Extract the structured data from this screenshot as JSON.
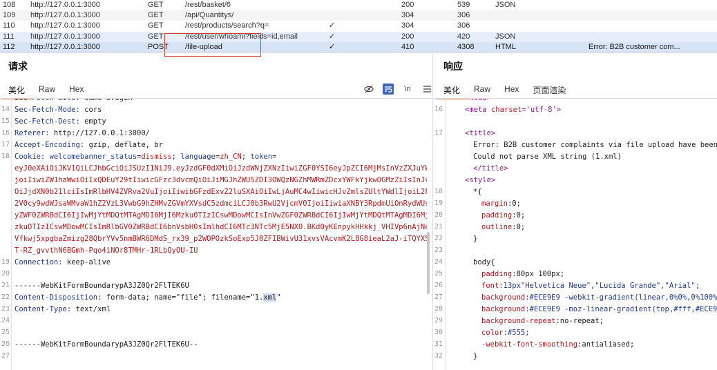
{
  "requests": [
    {
      "num": "108",
      "host": "http://127.0.0.1:3000",
      "method": "GET",
      "url": "/rest/basket/6",
      "check": "",
      "status": "200",
      "length": "539",
      "mime": "JSON",
      "comment": ""
    },
    {
      "num": "109",
      "host": "http://127.0.0.1:3000",
      "method": "GET",
      "url": "/api/Quantitys/",
      "check": "",
      "status": "304",
      "length": "306",
      "mime": "",
      "comment": ""
    },
    {
      "num": "110",
      "host": "http://127.0.0.1:3000",
      "method": "GET",
      "url": "/rest/products/search?q=",
      "check": "✓",
      "status": "304",
      "length": "306",
      "mime": "",
      "comment": ""
    },
    {
      "num": "111",
      "host": "http://127.0.0.1:3000",
      "method": "GET",
      "url": "/rest/user/whoami?fields=id,email",
      "check": "✓",
      "status": "200",
      "length": "420",
      "mime": "JSON",
      "comment": ""
    },
    {
      "num": "112",
      "host": "http://127.0.0.1:3000",
      "method": "POST",
      "url": "/file-upload",
      "check": "✓",
      "status": "410",
      "length": "4308",
      "mime": "HTML",
      "comment": "Error: B2B customer com..."
    }
  ],
  "request_panel": {
    "title": "请求",
    "tabs": [
      "美化",
      "Raw",
      "Hex"
    ],
    "tools": {
      "hide": "⊘",
      "wrap": "≡",
      "newline": "\\n",
      "menu": "☰"
    }
  },
  "response_panel": {
    "title": "响应",
    "tabs": [
      "美化",
      "Raw",
      "Hex",
      "页面渲染"
    ]
  },
  "request_lines": [
    {
      "n": "13",
      "k": "Sec-Fetch-Site:",
      "v": " same-origin"
    },
    {
      "n": "14",
      "k": "Sec-Fetch-Mode:",
      "v": " cors"
    },
    {
      "n": "15",
      "k": "Sec-Fetch-Dest:",
      "v": " empty"
    },
    {
      "n": "16",
      "k": "Referer:",
      "v": " http://127.0.0.1:3000/"
    },
    {
      "n": "17",
      "k": "Accept-Encoding:",
      "v": " gzip, deflate, br"
    },
    {
      "n": "18",
      "k": "Cookie:",
      "v": " "
    }
  ],
  "cookie": {
    "p1k": "welcomebanner_status",
    "p1v": "dismiss",
    "p2k": "language",
    "p2v": "zh_CN",
    "p3k": "token",
    "token_lines": [
      "eyJ0eXAiOiJKV1QiLCJhbGciOiJSUzI1NiJ9.eyJzdGF0dXMiOiJzdWNjZXNzIiwiZGF0YSI6eyJpZCI6MjMsInVzZXJuYW1lI",
      "joiIiwiZW1haWwiOiIxQDEuY29tIiwicGFzc3dvcmQiOiJiMGJhZWU5ZDI3OWQzNGZhMWRmZDcxYWFkYjkwOGMzZiIsInJvbGUi",
      "OiJjdXN0b21lciIsImRlbHV4ZVRva2VuIjoiIiwibGFzdExvZ2luSXAiOiIwLjAuMC4wIiwicHJvZmlsZUltYWdlIjoiL2Fzc",
      "2V0cy9wdWJsaWMvaW1hZ2VzL3VwbG9hZHMvZGVmYXVsdC5zdmciLCJ0b3RwU2VjcmV0IjoiIiwiaXNBY3RpdmUiOnRydWUsImN",
      "yZWF0ZWRBdCI6IjIwMjYtMDQtMTAgMDI6MjI6Mzku0TIzICswMDowMCIsInVwZGF0ZWRBdCI6IjIwMjYtMDQtMTAgMDI6MjI6M",
      "zkuOTIzICswMDowMCIsImRlbGV0ZWRBdCI6bnVsbH0sImlhdCI6MTc3NTc5MjE5NX0.BKd0yKEnpykHHkkj_VHIVp6nAjNeqgQ",
      "Vfkwj5xpgbaZmizg28QbrYVv5nmBWR6DMdS_rx39_p2WOPOzkSoExp5J0ZFIBWivU31xvsVAcvmK2L8G8ieaL2aJ-iTQYXS-Bp",
      "T-RZ_gvvthN6BGmh-Pqo4iNOr8TMHr-1RLbQyOU-IU"
    ]
  },
  "request_tail": [
    {
      "n": "19",
      "k": "Connection:",
      "v": " keep-alive"
    },
    {
      "n": "20",
      "t": ""
    },
    {
      "n": "21",
      "t": "------WebKitFormBoundarypA3JZ0Qr2FlTEK6U"
    },
    {
      "n": "22",
      "k": "Content-Disposition:",
      "v": " form-data; name=\"file\"; filename=\"1.",
      "hl": "xml",
      "v2": "\""
    },
    {
      "n": "23",
      "k": "Content-Type:",
      "v": " text/xml"
    },
    {
      "n": "24",
      "t": ""
    },
    {
      "n": "25",
      "t": ""
    },
    {
      "n": "26",
      "t": "------WebKitFormBoundarypA3JZ0Qr2FlTEK6U--"
    },
    {
      "n": "27",
      "t": ""
    }
  ],
  "response_lines": {
    "l15": "<head>",
    "l16_tag": "<meta ",
    "l16_attr": "charset",
    "l16_val": "='utf-8'>",
    "l17": "<title>",
    "l18": "Error: B2B customer complaints via file upload have been de",
    "l18b": "Could not parse XML string (1.xml)",
    "l19": "</title>",
    "l20": "<style>",
    "l21": "*{",
    "l22p": "margin",
    "l22v": ":0;",
    "l23p": "padding",
    "l23v": ":0;",
    "l24p": "outline",
    "l24v": ":0;",
    "l25": "}",
    "l26": "",
    "l27": "body{",
    "l28p": "padding",
    "l28v": ":80px 100px;",
    "l29p": "font",
    "l29v": ":13px\"Helvetica Neue\",\"Lucida Grande\",\"Arial\";",
    "l30p": "background",
    "l30v": ":#ECE9E9 -webkit-gradient(linear,0%0%,0%100%,fro",
    "l31p": "background",
    "l31v": ":#ECE9E9 -moz-linear-gradient(top,#fff,#ECE9E9);",
    "l32p": "background-repeat",
    "l32v": ":no-repeat;",
    "l33p": "color",
    "l33v": ":#555;",
    "l34p": "-webkit-font-smoothing",
    "l34v": ":antialiased;",
    "l35": "}",
    "nums": [
      "15",
      "16",
      "",
      "17",
      "",
      "",
      "",
      "",
      "18",
      "19",
      "20",
      "21",
      "22",
      "23",
      "24",
      "25",
      "26",
      "27",
      "28",
      "29",
      "30",
      "31",
      "32"
    ]
  }
}
